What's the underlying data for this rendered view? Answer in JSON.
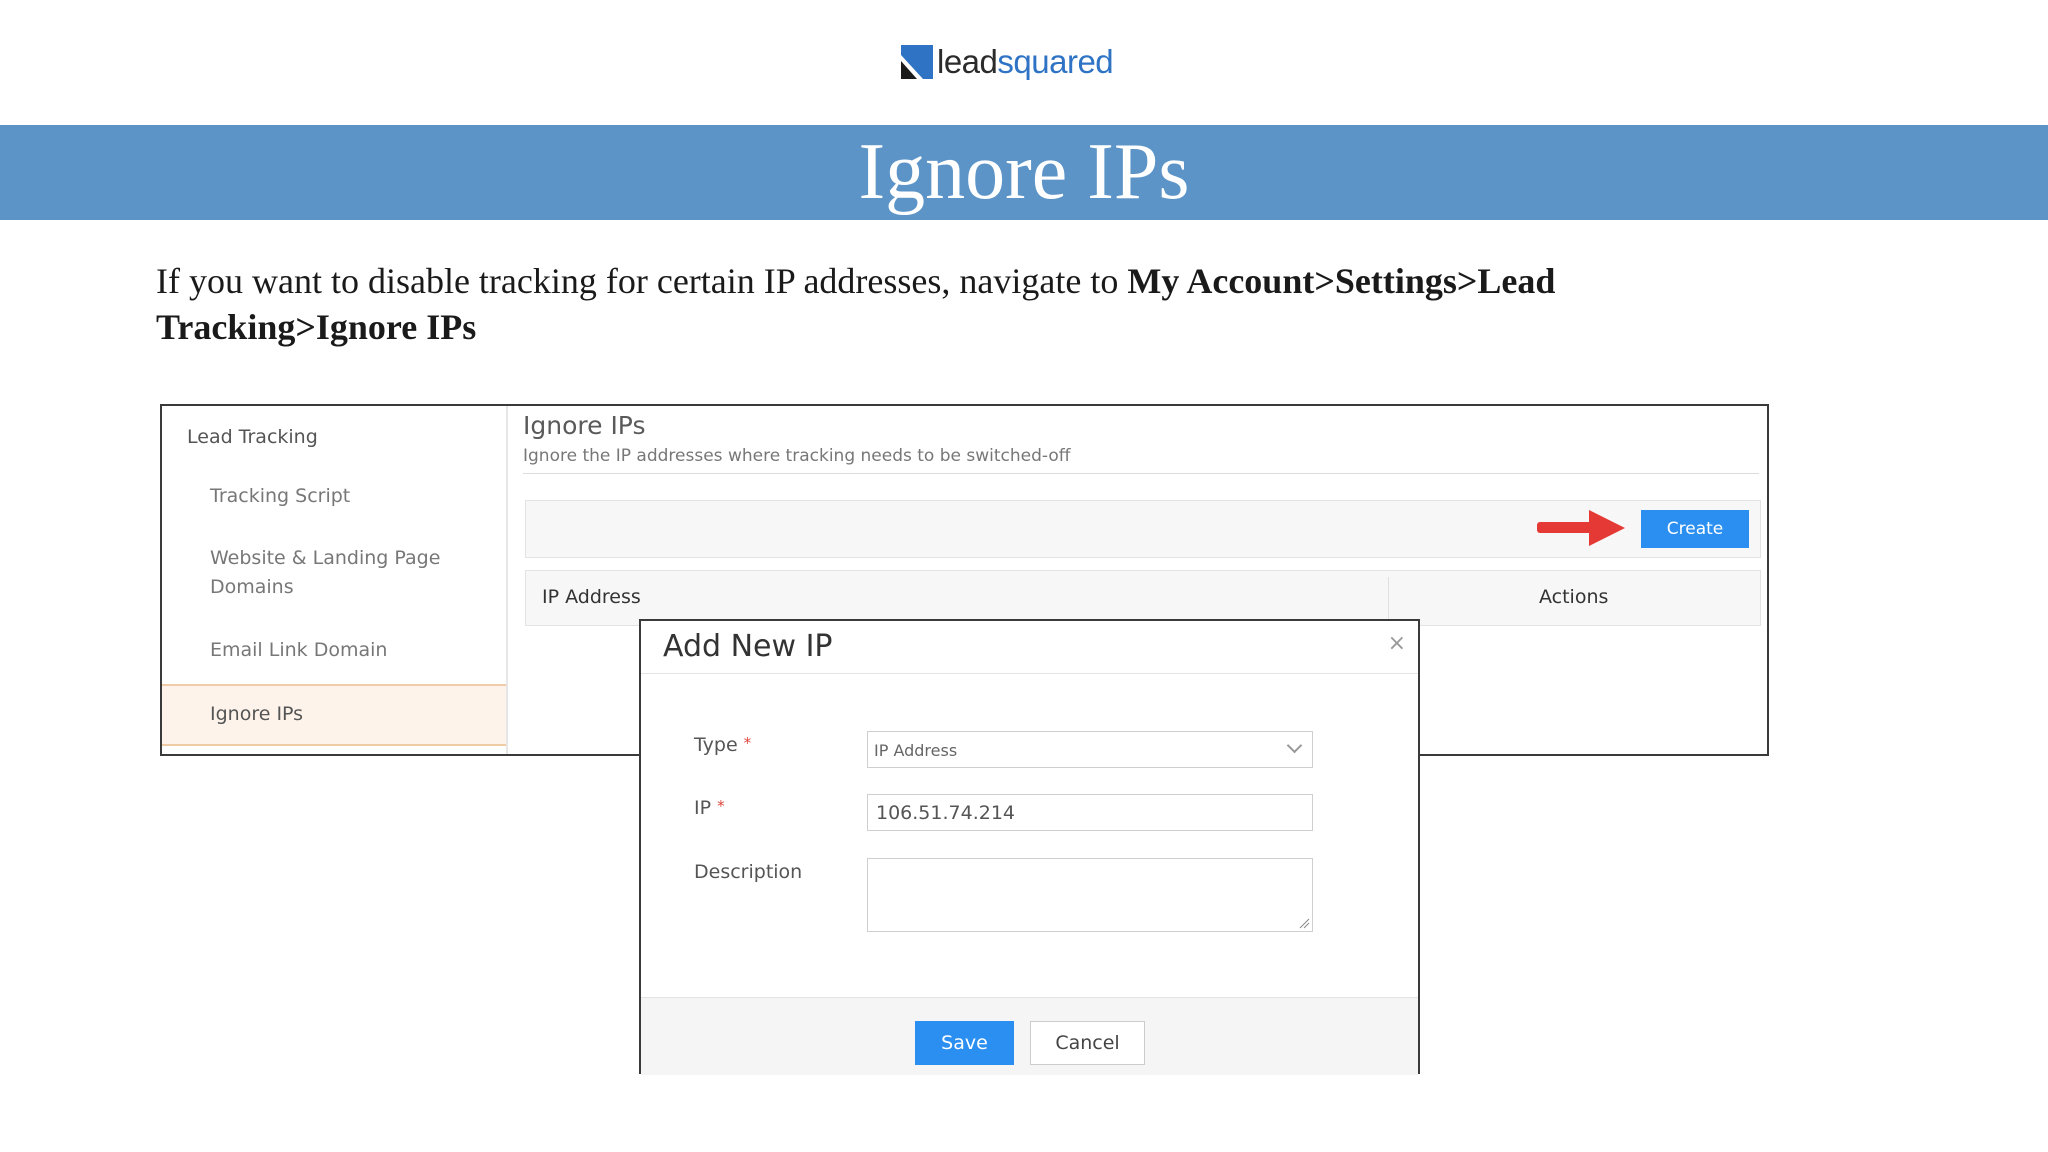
{
  "logo": {
    "lead": "lead",
    "squared": "squared"
  },
  "banner": {
    "title": "Ignore IPs"
  },
  "intro": {
    "text_before": "If you want to disable tracking for certain IP addresses, navigate to ",
    "path_bold": "My Account>Settings>Lead Tracking>Ignore IPs"
  },
  "sidebar": {
    "heading": "Lead Tracking",
    "items": [
      {
        "label": "Tracking Script"
      },
      {
        "label": "Website & Landing Page Domains"
      },
      {
        "label": "Email Link Domain"
      },
      {
        "label": "Ignore IPs",
        "active": true
      }
    ]
  },
  "main": {
    "title": "Ignore IPs",
    "subtitle": "Ignore the IP addresses where tracking needs to be switched-off",
    "create_label": "Create",
    "columns": [
      "IP Address",
      "Actions"
    ]
  },
  "modal": {
    "title": "Add New IP",
    "close_glyph": "×",
    "fields": {
      "type": {
        "label": "Type",
        "value": "IP Address"
      },
      "ip": {
        "label": "IP",
        "value": "106.51.74.214"
      },
      "description": {
        "label": "Description",
        "value": ""
      }
    },
    "required_mark": "*",
    "save_label": "Save",
    "cancel_label": "Cancel"
  },
  "colors": {
    "banner": "#5c94c7",
    "primary_button": "#2a8ff0",
    "arrow": "#e53935",
    "active_item_bg": "#fdf3ea",
    "logo_blue": "#2f73c5"
  },
  "icons": {
    "logo_mark": "leadsquared-logo-mark",
    "arrow": "right-arrow-pointer",
    "close": "close-icon",
    "dropdown": "chevron-down-icon",
    "resize": "resize-grip-icon"
  }
}
